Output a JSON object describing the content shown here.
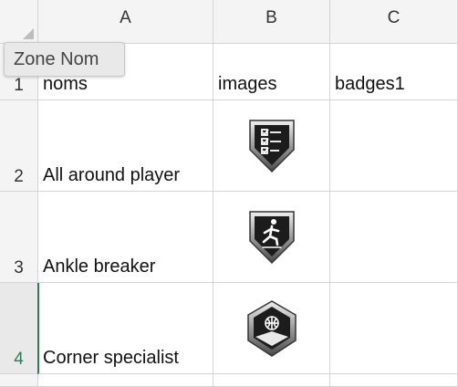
{
  "name_box": {
    "value": "Zone Nom"
  },
  "columns": [
    "A",
    "B",
    "C"
  ],
  "rows": [
    {
      "num": "1",
      "name": "noms",
      "image_header": "images",
      "c": "badges1"
    },
    {
      "num": "2",
      "name": "All around player",
      "badge_icon": "checklist-icon"
    },
    {
      "num": "3",
      "name": "Ankle breaker",
      "badge_icon": "player-running-icon"
    },
    {
      "num": "4",
      "name": "Corner specialist",
      "badge_icon": "basketball-corner-icon"
    }
  ],
  "colors": {
    "selected_row_accent": "#2e7d4f",
    "grid_line": "#d4d4d4",
    "header_bg": "#f4f4f4"
  }
}
